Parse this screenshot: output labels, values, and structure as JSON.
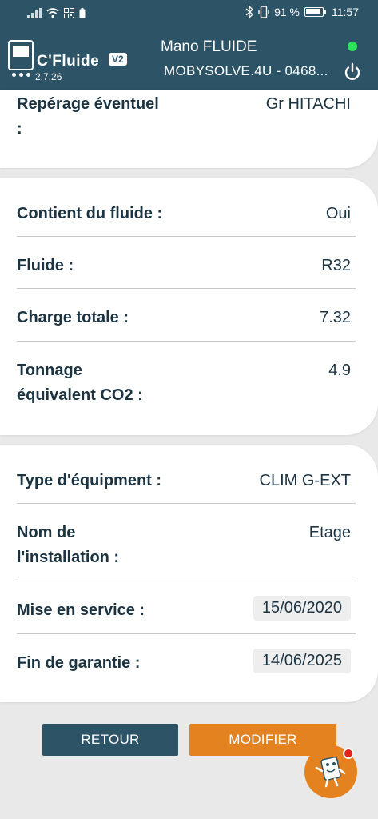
{
  "status_bar": {
    "battery_percent": "91 %",
    "time": "11:57",
    "icons": [
      "signal-icon",
      "wifi-icon",
      "qr-icon",
      "battery-small-icon",
      "bluetooth-icon",
      "vibrate-icon",
      "battery-icon"
    ]
  },
  "header": {
    "app_name": "C'Fluide",
    "app_badge": "V2",
    "app_version": "2.7.26",
    "device_name": "Mano FLUIDE",
    "device_id": "MOBYSOLVE.4U - 0468...",
    "connection_color": "#2ee05a"
  },
  "card1": {
    "label_line1": "Repérage éventuel",
    "label_line2": ":",
    "value": "Gr HITACHI"
  },
  "card2": {
    "rows": [
      {
        "label": "Contient du fluide :",
        "value": "Oui"
      },
      {
        "label": "Fluide :",
        "value": "R32"
      },
      {
        "label": "Charge totale :",
        "value": "7.32"
      },
      {
        "label_line1": "Tonnage",
        "label_line2": "équivalent CO2 :",
        "value": "4.9"
      }
    ]
  },
  "card3": {
    "rows": [
      {
        "label": "Type d'équipment :",
        "value": "CLIM G-EXT"
      },
      {
        "label_line1": "Nom de",
        "label_line2": "l'installation :",
        "value": "Etage"
      },
      {
        "label": "Mise en service :",
        "value": "15/06/2020"
      },
      {
        "label": "Fin de garantie :",
        "value": "14/06/2025"
      }
    ]
  },
  "buttons": {
    "back": "RETOUR",
    "edit": "MODIFIER"
  },
  "colors": {
    "primary": "#2c5366",
    "accent": "#e58220",
    "notification": "#e3261d"
  }
}
